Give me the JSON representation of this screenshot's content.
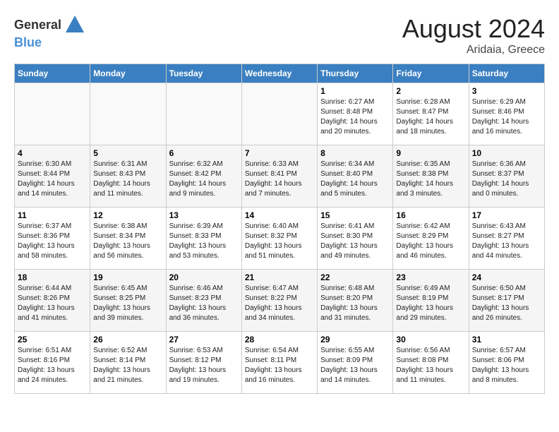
{
  "header": {
    "logo_general": "General",
    "logo_blue": "Blue",
    "month_year": "August 2024",
    "location": "Aridaia, Greece"
  },
  "weekdays": [
    "Sunday",
    "Monday",
    "Tuesday",
    "Wednesday",
    "Thursday",
    "Friday",
    "Saturday"
  ],
  "weeks": [
    [
      {
        "day": "",
        "info": ""
      },
      {
        "day": "",
        "info": ""
      },
      {
        "day": "",
        "info": ""
      },
      {
        "day": "",
        "info": ""
      },
      {
        "day": "1",
        "info": "Sunrise: 6:27 AM\nSunset: 8:48 PM\nDaylight: 14 hours\nand 20 minutes."
      },
      {
        "day": "2",
        "info": "Sunrise: 6:28 AM\nSunset: 8:47 PM\nDaylight: 14 hours\nand 18 minutes."
      },
      {
        "day": "3",
        "info": "Sunrise: 6:29 AM\nSunset: 8:46 PM\nDaylight: 14 hours\nand 16 minutes."
      }
    ],
    [
      {
        "day": "4",
        "info": "Sunrise: 6:30 AM\nSunset: 8:44 PM\nDaylight: 14 hours\nand 14 minutes."
      },
      {
        "day": "5",
        "info": "Sunrise: 6:31 AM\nSunset: 8:43 PM\nDaylight: 14 hours\nand 11 minutes."
      },
      {
        "day": "6",
        "info": "Sunrise: 6:32 AM\nSunset: 8:42 PM\nDaylight: 14 hours\nand 9 minutes."
      },
      {
        "day": "7",
        "info": "Sunrise: 6:33 AM\nSunset: 8:41 PM\nDaylight: 14 hours\nand 7 minutes."
      },
      {
        "day": "8",
        "info": "Sunrise: 6:34 AM\nSunset: 8:40 PM\nDaylight: 14 hours\nand 5 minutes."
      },
      {
        "day": "9",
        "info": "Sunrise: 6:35 AM\nSunset: 8:38 PM\nDaylight: 14 hours\nand 3 minutes."
      },
      {
        "day": "10",
        "info": "Sunrise: 6:36 AM\nSunset: 8:37 PM\nDaylight: 14 hours\nand 0 minutes."
      }
    ],
    [
      {
        "day": "11",
        "info": "Sunrise: 6:37 AM\nSunset: 8:36 PM\nDaylight: 13 hours\nand 58 minutes."
      },
      {
        "day": "12",
        "info": "Sunrise: 6:38 AM\nSunset: 8:34 PM\nDaylight: 13 hours\nand 56 minutes."
      },
      {
        "day": "13",
        "info": "Sunrise: 6:39 AM\nSunset: 8:33 PM\nDaylight: 13 hours\nand 53 minutes."
      },
      {
        "day": "14",
        "info": "Sunrise: 6:40 AM\nSunset: 8:32 PM\nDaylight: 13 hours\nand 51 minutes."
      },
      {
        "day": "15",
        "info": "Sunrise: 6:41 AM\nSunset: 8:30 PM\nDaylight: 13 hours\nand 49 minutes."
      },
      {
        "day": "16",
        "info": "Sunrise: 6:42 AM\nSunset: 8:29 PM\nDaylight: 13 hours\nand 46 minutes."
      },
      {
        "day": "17",
        "info": "Sunrise: 6:43 AM\nSunset: 8:27 PM\nDaylight: 13 hours\nand 44 minutes."
      }
    ],
    [
      {
        "day": "18",
        "info": "Sunrise: 6:44 AM\nSunset: 8:26 PM\nDaylight: 13 hours\nand 41 minutes."
      },
      {
        "day": "19",
        "info": "Sunrise: 6:45 AM\nSunset: 8:25 PM\nDaylight: 13 hours\nand 39 minutes."
      },
      {
        "day": "20",
        "info": "Sunrise: 6:46 AM\nSunset: 8:23 PM\nDaylight: 13 hours\nand 36 minutes."
      },
      {
        "day": "21",
        "info": "Sunrise: 6:47 AM\nSunset: 8:22 PM\nDaylight: 13 hours\nand 34 minutes."
      },
      {
        "day": "22",
        "info": "Sunrise: 6:48 AM\nSunset: 8:20 PM\nDaylight: 13 hours\nand 31 minutes."
      },
      {
        "day": "23",
        "info": "Sunrise: 6:49 AM\nSunset: 8:19 PM\nDaylight: 13 hours\nand 29 minutes."
      },
      {
        "day": "24",
        "info": "Sunrise: 6:50 AM\nSunset: 8:17 PM\nDaylight: 13 hours\nand 26 minutes."
      }
    ],
    [
      {
        "day": "25",
        "info": "Sunrise: 6:51 AM\nSunset: 8:16 PM\nDaylight: 13 hours\nand 24 minutes."
      },
      {
        "day": "26",
        "info": "Sunrise: 6:52 AM\nSunset: 8:14 PM\nDaylight: 13 hours\nand 21 minutes."
      },
      {
        "day": "27",
        "info": "Sunrise: 6:53 AM\nSunset: 8:12 PM\nDaylight: 13 hours\nand 19 minutes."
      },
      {
        "day": "28",
        "info": "Sunrise: 6:54 AM\nSunset: 8:11 PM\nDaylight: 13 hours\nand 16 minutes."
      },
      {
        "day": "29",
        "info": "Sunrise: 6:55 AM\nSunset: 8:09 PM\nDaylight: 13 hours\nand 14 minutes."
      },
      {
        "day": "30",
        "info": "Sunrise: 6:56 AM\nSunset: 8:08 PM\nDaylight: 13 hours\nand 11 minutes."
      },
      {
        "day": "31",
        "info": "Sunrise: 6:57 AM\nSunset: 8:06 PM\nDaylight: 13 hours\nand 8 minutes."
      }
    ]
  ]
}
